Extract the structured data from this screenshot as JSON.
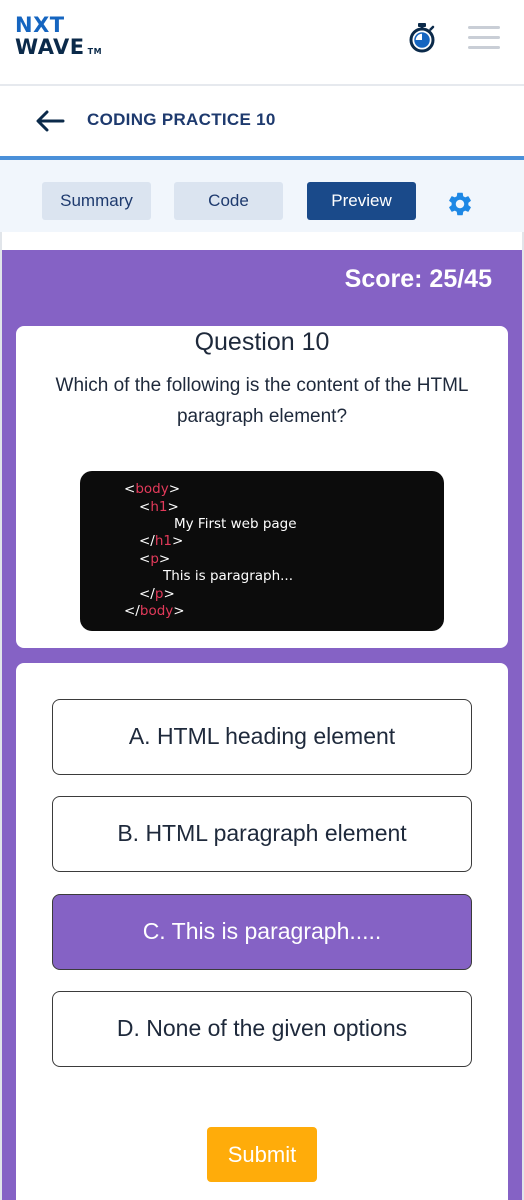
{
  "header": {
    "logo_line1": "NXT",
    "logo_line2": "WAVE",
    "logo_tm": "TM",
    "icons": [
      "timer-icon",
      "menu-icon"
    ]
  },
  "title_bar": {
    "back_icon": "arrow-left-icon",
    "title": "CODING PRACTICE 10"
  },
  "tabs": [
    {
      "label": "Summary",
      "active": false
    },
    {
      "label": "Code",
      "active": false
    },
    {
      "label": "Preview",
      "active": true
    }
  ],
  "settings_icon": "gear-icon",
  "quiz": {
    "score": "Score: 25/45",
    "question_title": "Question 10",
    "question_text": "Which of the following is the content of the HTML paragraph element?",
    "code_lines": [
      {
        "open": "<",
        "tag": "body",
        "close": ">"
      },
      {
        "open": "<",
        "tag": "h1",
        "close": ">"
      },
      {
        "text": "My First web page"
      },
      {
        "open": "</",
        "tag": "h1",
        "close": ">"
      },
      {
        "open": "<",
        "tag": "p",
        "close": ">"
      },
      {
        "text": "This is paragraph..."
      },
      {
        "open": "</",
        "tag": "p",
        "close": ">"
      },
      {
        "open": "</",
        "tag": "body",
        "close": ">"
      }
    ],
    "options": [
      {
        "label": "A. HTML heading element",
        "selected": false
      },
      {
        "label": "B. HTML paragraph element",
        "selected": false
      },
      {
        "label": "C. This is paragraph.....",
        "selected": true
      },
      {
        "label": "D. None of the given options",
        "selected": false
      }
    ],
    "submit_label": "Submit"
  },
  "colors": {
    "primary_blue": "#1a4a8a",
    "purple": "#8562c5",
    "submit_orange": "#ffac0a",
    "code_tag_red": "#e23a5a",
    "code_bg": "#0c0c0c"
  }
}
